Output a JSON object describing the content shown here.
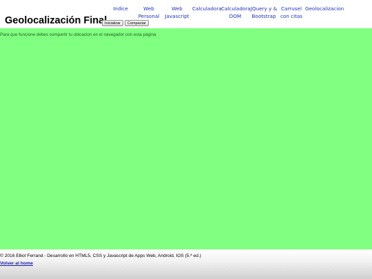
{
  "header": {
    "title": "Geolocalización Final",
    "buttons": {
      "initialize_label": "Inicializar",
      "compact_label": "Compactar"
    }
  },
  "nav": {
    "items": [
      {
        "id": "indice",
        "label": "Indice"
      },
      {
        "id": "web-personal",
        "label": "Web\nPersonal"
      },
      {
        "id": "web-javascript",
        "label": "Web\nJavascript"
      },
      {
        "id": "calculadora",
        "label": "Calculadora"
      },
      {
        "id": "calculadora-dom",
        "label": "Calculadora\nDOM"
      },
      {
        "id": "jquery-bootstrap",
        "label": "JQuery y &\nBootstrap"
      },
      {
        "id": "carrusel-citas",
        "label": "Carrusel\ncon citas"
      },
      {
        "id": "geolocalizacion",
        "label": "Geolocalizacion"
      }
    ]
  },
  "main": {
    "notice": "Para que funcione debes compartir tu ubicacion en el navegador con esta página"
  },
  "footer": {
    "copyright": "© 2016 Elliot Ferrand - Desarrollo en HTML5, CSS y Javascript de Apps Web, Android, IOS (5.ª ed.)",
    "back_link": "Volver al home"
  },
  "colors": {
    "main_background": "#80ff80",
    "nav_link": "#1f2fbf",
    "footer_link": "#1a1aa8"
  }
}
